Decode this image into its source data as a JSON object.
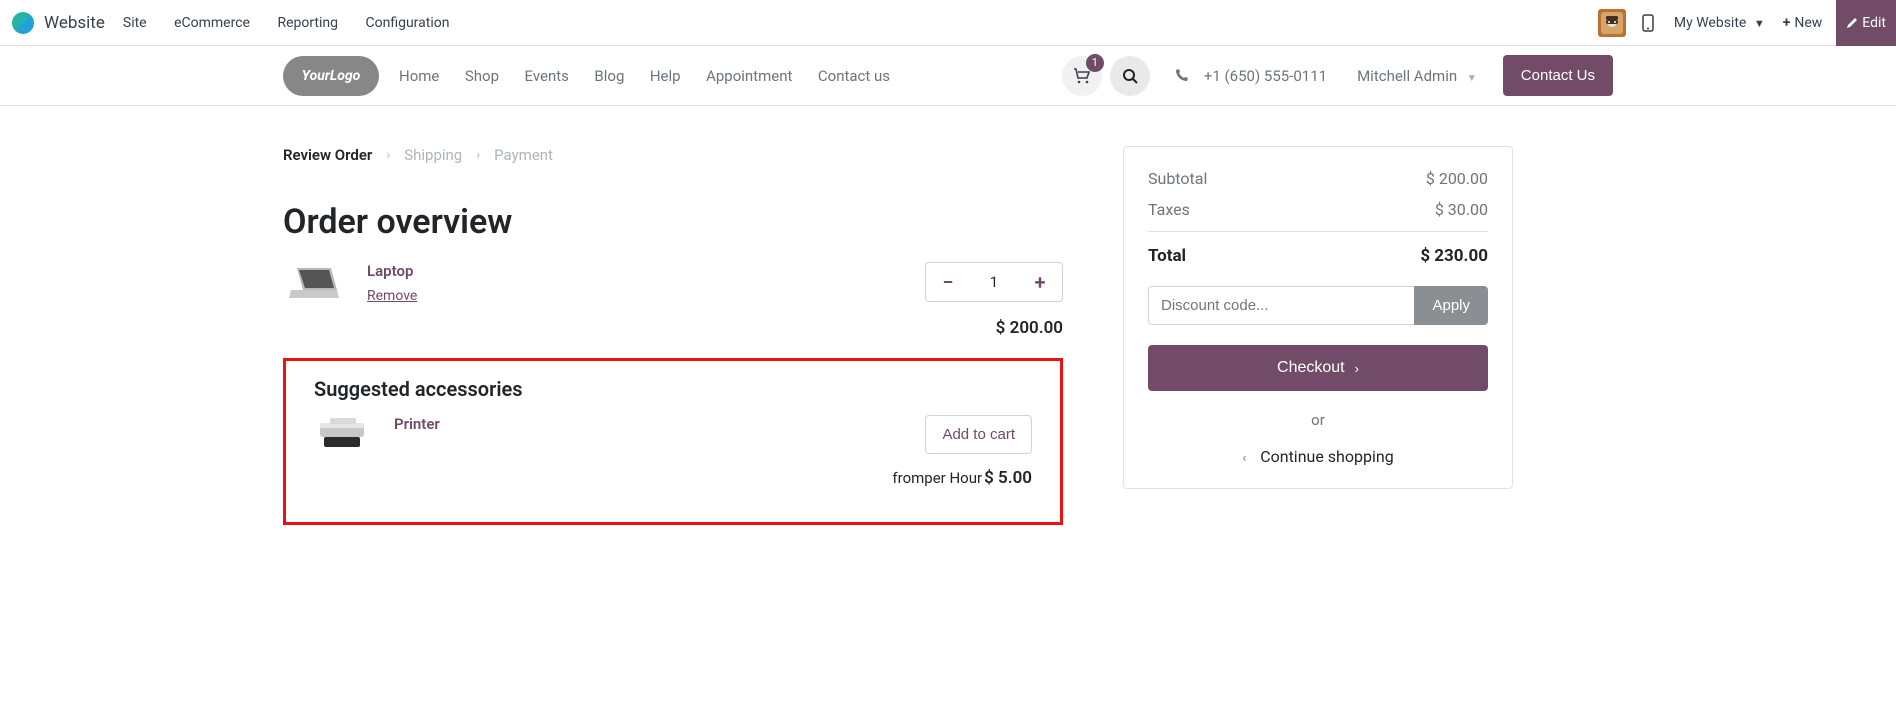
{
  "admin": {
    "app": "Website",
    "menus": [
      "Site",
      "eCommerce",
      "Reporting",
      "Configuration"
    ],
    "site_selector": "My Website",
    "new_label": "New",
    "edit_label": "Edit"
  },
  "nav": {
    "items": [
      "Home",
      "Shop",
      "Events",
      "Blog",
      "Help",
      "Appointment",
      "Contact us"
    ],
    "phone": "+1 (650) 555-0111",
    "user": "Mitchell Admin",
    "contact_btn": "Contact Us",
    "cart_badge": "1"
  },
  "wizard": {
    "steps": [
      "Review Order",
      "Shipping",
      "Payment"
    ],
    "active_index": 0
  },
  "title": "Order overview",
  "cart": {
    "item": {
      "name": "Laptop",
      "remove": "Remove",
      "qty": "1",
      "price": "$ 200.00"
    }
  },
  "suggest": {
    "title": "Suggested accessories",
    "item": {
      "name": "Printer",
      "add_btn": "Add to cart",
      "rental_prefix": "from",
      "rental_unit": "per Hour",
      "price": "$ 5.00"
    }
  },
  "summary": {
    "subtotal_label": "Subtotal",
    "subtotal_value": "$ 200.00",
    "taxes_label": "Taxes",
    "taxes_value": "$ 30.00",
    "total_label": "Total",
    "total_value": "$ 230.00",
    "discount_placeholder": "Discount code...",
    "apply_label": "Apply",
    "checkout_label": "Checkout",
    "or_label": "or",
    "continue_label": "Continue shopping"
  }
}
